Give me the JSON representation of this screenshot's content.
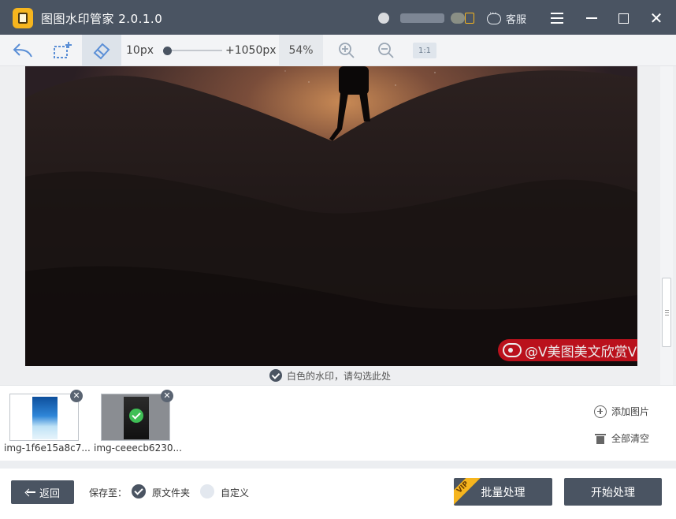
{
  "app": {
    "title": "图图水印管家  2.0.1.0",
    "service_label": "客服"
  },
  "toolbar": {
    "brush_min": "10px",
    "brush_max": "+1050px",
    "brush_fraction": 0.05,
    "zoom": "54%",
    "ratio_label": "1:1"
  },
  "canvas": {
    "watermark_text": "@V美图美文欣赏V",
    "hint": "白色的水印，请勾选此处"
  },
  "thumbnails": [
    {
      "label": "img-1f6e15a8c7...",
      "selected": false
    },
    {
      "label": "img-ceeecb6230...",
      "selected": true
    }
  ],
  "side_actions": {
    "add": "添加图片",
    "clear": "全部清空"
  },
  "bottom": {
    "back": "返回",
    "save_to": "保存至：",
    "opt_original": "原文件夹",
    "opt_custom": "自定义",
    "vip": "VIP",
    "batch": "批量处理",
    "start": "开始处理"
  },
  "colors": {
    "titlebar": "#4a5462",
    "accent": "#4a5462",
    "vip": "#f6b51e",
    "watermark": "#c9121e",
    "check_green": "#3fbf56"
  }
}
